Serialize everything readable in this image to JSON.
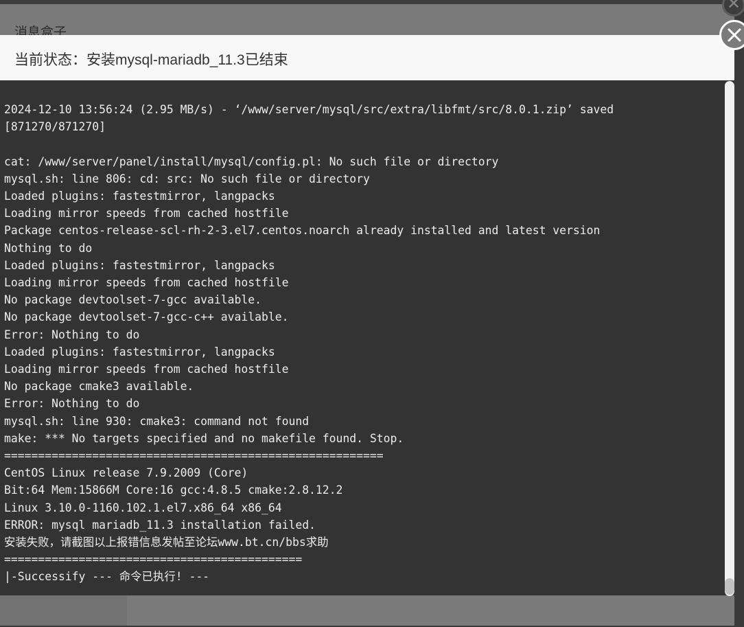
{
  "background_window": {
    "title": "消息盒子",
    "close_icon": "close-icon"
  },
  "dialog": {
    "title": "当前状态：安装mysql-mariadb_11.3已结束",
    "close_icon": "close-icon"
  },
  "console": {
    "lines": [
      "2024-12-10 13:56:24 (2.95 MB/s) - ‘/www/server/mysql/src/extra/libfmt/src/8.0.1.zip’ saved",
      "[871270/871270]",
      "",
      "cat: /www/server/panel/install/mysql/config.pl: No such file or directory",
      "mysql.sh: line 806: cd: src: No such file or directory",
      "Loaded plugins: fastestmirror, langpacks",
      "Loading mirror speeds from cached hostfile",
      "Package centos-release-scl-rh-2-3.el7.centos.noarch already installed and latest version",
      "Nothing to do",
      "Loaded plugins: fastestmirror, langpacks",
      "Loading mirror speeds from cached hostfile",
      "No package devtoolset-7-gcc available.",
      "No package devtoolset-7-gcc-c++ available.",
      "Error: Nothing to do",
      "Loaded plugins: fastestmirror, langpacks",
      "Loading mirror speeds from cached hostfile",
      "No package cmake3 available.",
      "Error: Nothing to do",
      "mysql.sh: line 930: cmake3: command not found",
      "make: *** No targets specified and no makefile found. Stop.",
      "========================================================",
      "CentOS Linux release 7.9.2009 (Core)",
      "Bit:64 Mem:15866M Core:16 gcc:4.8.5 cmake:2.8.12.2",
      "Linux 3.10.0-1160.102.1.el7.x86_64 x86_64",
      "ERROR: mysql mariadb_11.3 installation failed.",
      "安装失败，请截图以上报错信息发帖至论坛www.bt.cn/bbs求助",
      "============================================",
      "|-Successify --- 命令已执行! ---"
    ]
  },
  "scrollbar": {
    "position_fraction": 1.0
  }
}
